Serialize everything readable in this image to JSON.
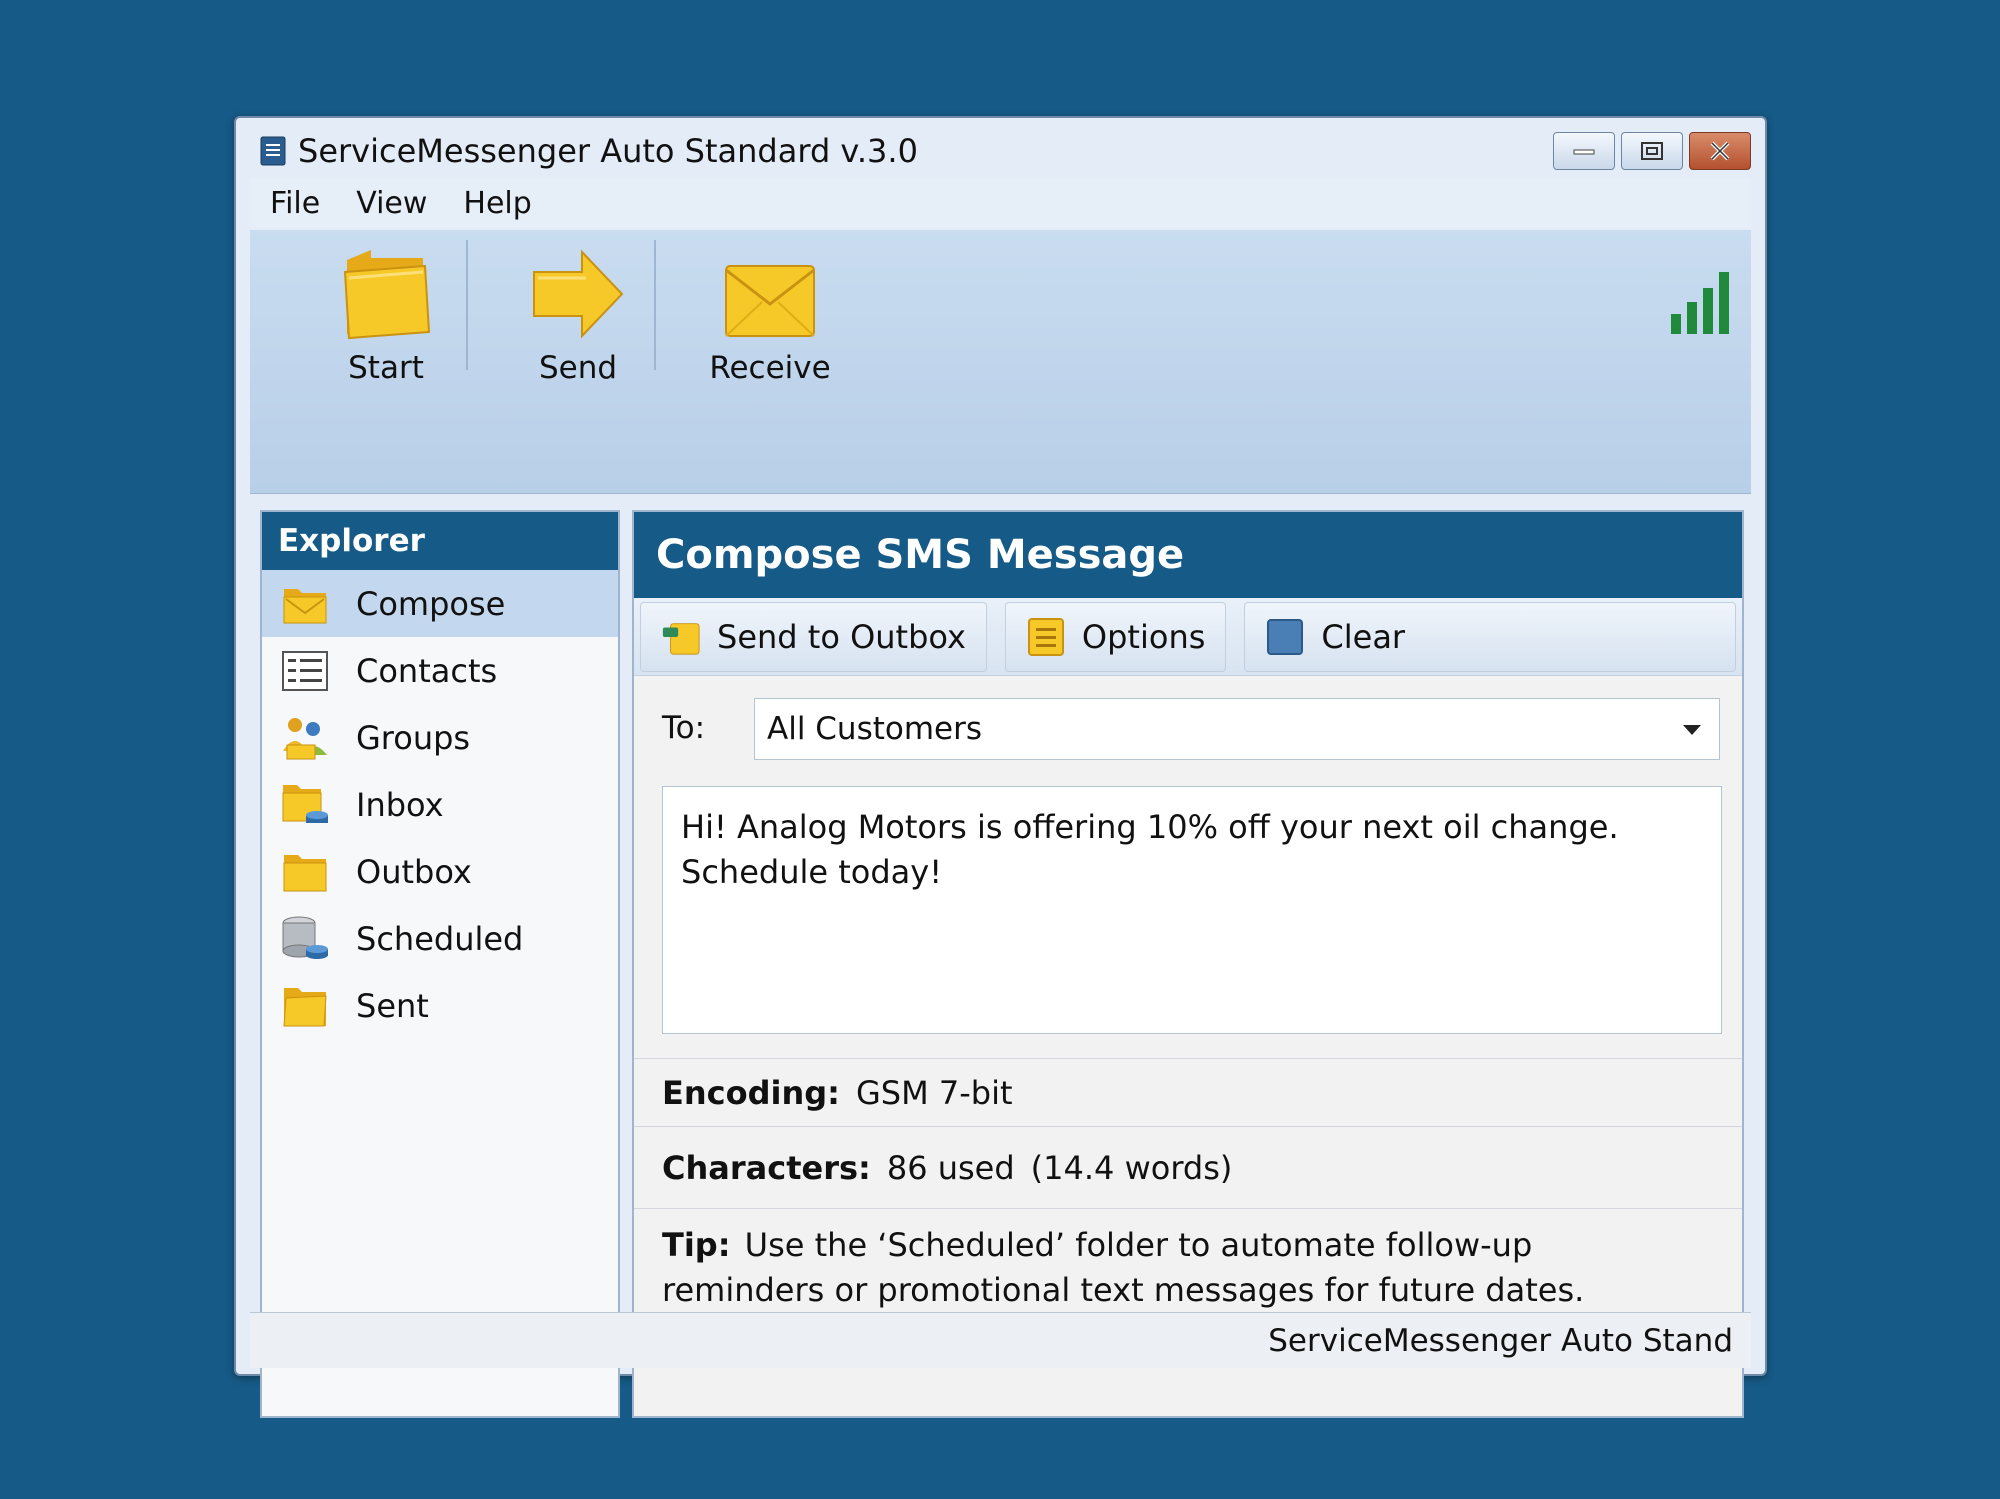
{
  "window": {
    "title": "ServiceMessenger Auto Standard v.3.0",
    "app_icon": "app-window-icon"
  },
  "menu": [
    "File",
    "View",
    "Help"
  ],
  "toolbar": {
    "buttons": [
      {
        "label": "Start",
        "icon": "folder-icon"
      },
      {
        "label": "Send",
        "icon": "arrow-right-icon"
      },
      {
        "label": "Receive",
        "icon": "envelope-icon"
      }
    ],
    "signal_icon": "signal-strength-icon"
  },
  "sidebar": {
    "title": "Explorer",
    "items": [
      {
        "label": "Compose",
        "icon": "compose-folder-icon",
        "active": true
      },
      {
        "label": "Contacts",
        "icon": "contacts-list-icon"
      },
      {
        "label": "Groups",
        "icon": "groups-icon"
      },
      {
        "label": "Inbox",
        "icon": "inbox-folder-icon"
      },
      {
        "label": "Outbox",
        "icon": "outbox-folder-icon"
      },
      {
        "label": "Scheduled",
        "icon": "scheduled-database-icon"
      },
      {
        "label": "Sent",
        "icon": "sent-folder-icon"
      }
    ]
  },
  "compose": {
    "title": "Compose SMS Message",
    "actions": [
      {
        "label": "Send to Outbox",
        "icon": "send-to-outbox-icon"
      },
      {
        "label": "Options",
        "icon": "options-icon"
      },
      {
        "label": "Clear",
        "icon": "clear-icon"
      }
    ],
    "to_label": "To:",
    "to_value": "All Customers",
    "message": "Hi! Analog Motors is offering 10% off your next oil change.\nSchedule today!",
    "encoding_label": "Encoding:",
    "encoding_value": "GSM 7-bit",
    "characters_label": "Characters:",
    "characters_value": "86 used (14.4 words)",
    "tip_label": "Tip:",
    "tip_text": "Use the ‘Scheduled’ folder to automate follow-up reminders or promotional text messages for future dates."
  },
  "statusbar": {
    "text": "ServiceMessenger Auto Stand"
  },
  "colors": {
    "background": "#165a87",
    "header_blue": "#165a87",
    "toolbar": "#c3d7ee",
    "folder_yellow": "#f5c518",
    "signal_green": "#1f8a3b"
  }
}
